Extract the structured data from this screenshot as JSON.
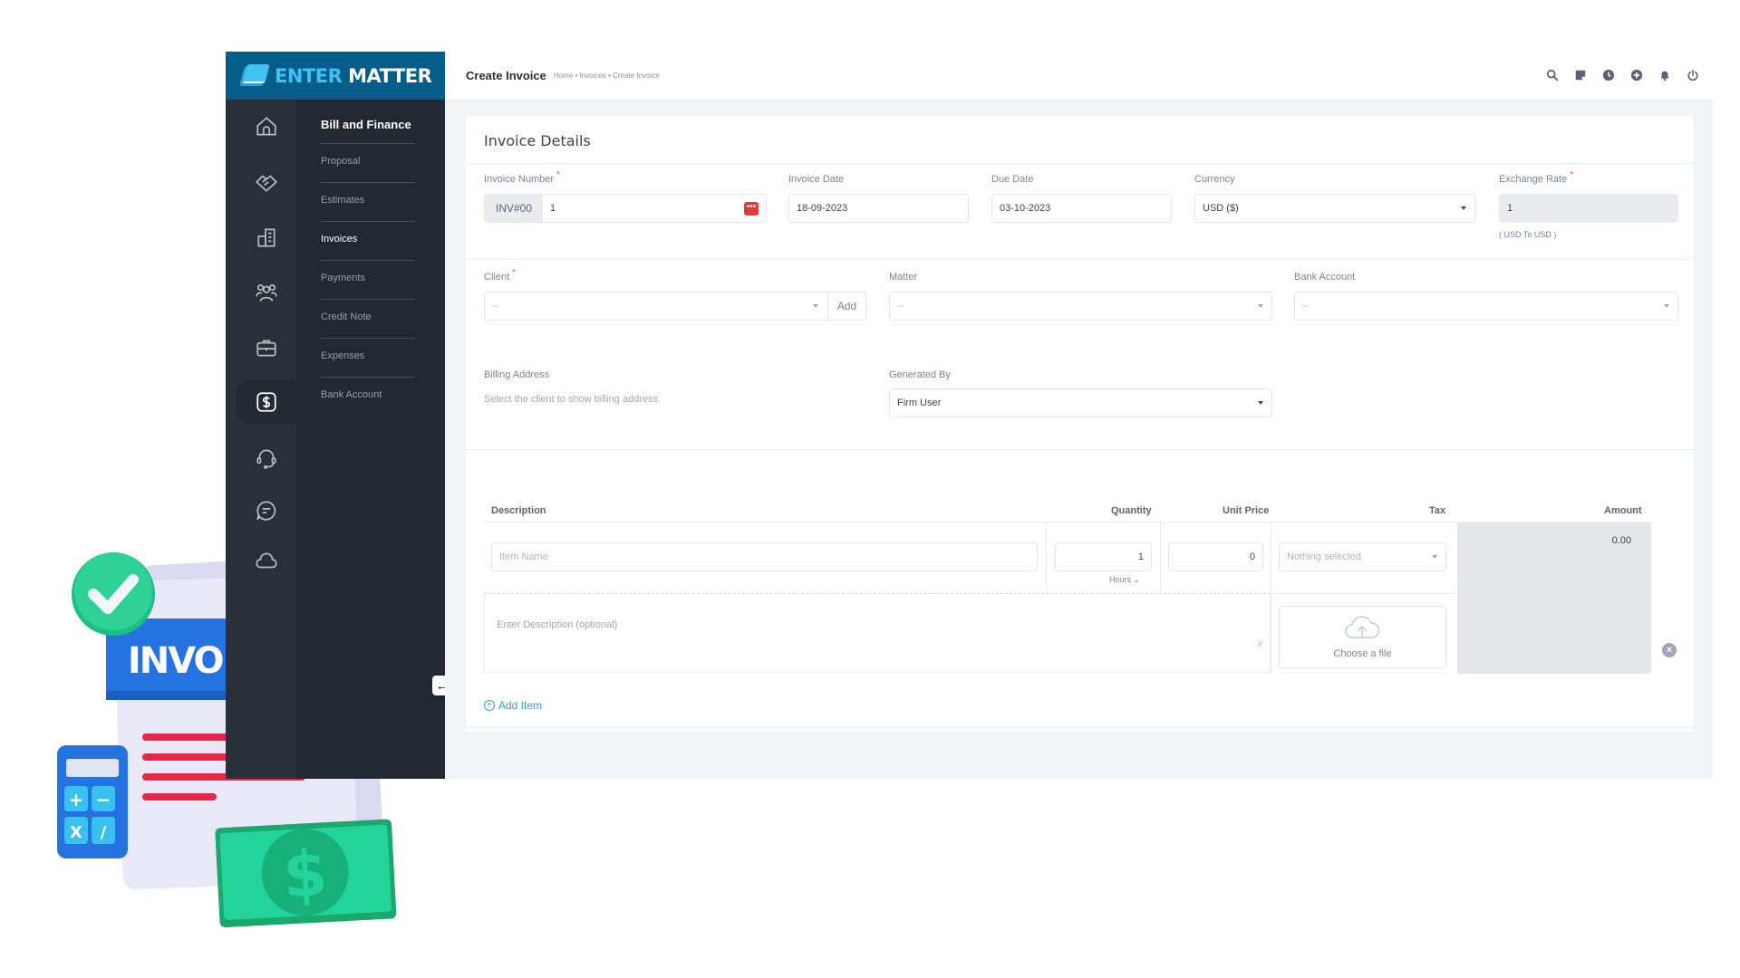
{
  "brand": {
    "name_part1": "ENTER",
    "name_part2": " MATTER"
  },
  "header": {
    "title": "Create Invoice",
    "breadcrumb": "Home • Invoices • Create Invoice",
    "icons": [
      "search-icon",
      "sticky-note-icon",
      "clock-icon",
      "plus-circle-icon",
      "bell-icon",
      "power-icon"
    ]
  },
  "sidebar": {
    "icons": [
      "home-icon",
      "handshake-icon",
      "building-icon",
      "users-icon",
      "briefcase-icon",
      "dollar-icon",
      "headset-icon",
      "chat-icon",
      "cloud-icon"
    ],
    "active_icon": "dollar-icon",
    "section_title": "Bill and Finance",
    "items": [
      {
        "label": "Proposal"
      },
      {
        "label": "Estimates"
      },
      {
        "label": "Invoices",
        "active": true
      },
      {
        "label": "Payments"
      },
      {
        "label": "Credit Note"
      },
      {
        "label": "Expenses"
      },
      {
        "label": "Bank Account"
      }
    ],
    "collapse_icon": "arrow-left-icon"
  },
  "form": {
    "title": "Invoice Details",
    "invoice_number": {
      "label": "Invoice Number",
      "required": "*",
      "prefix": "INV#00",
      "value": "1"
    },
    "invoice_date": {
      "label": "Invoice Date",
      "value": "18-09-2023"
    },
    "due_date": {
      "label": "Due Date",
      "value": "03-10-2023"
    },
    "currency": {
      "label": "Currency",
      "value": "USD ($)"
    },
    "exchange_rate": {
      "label": "Exchange Rate",
      "required": "*",
      "value": "1",
      "hint": "( USD To USD )"
    },
    "client": {
      "label": "Client",
      "required": "*",
      "placeholder": "--",
      "add_label": "Add"
    },
    "matter": {
      "label": "Matter",
      "placeholder": "--"
    },
    "bank_account": {
      "label": "Bank Account",
      "placeholder": "--"
    },
    "billing_address": {
      "label": "Billing Address",
      "helper": "Select the client to show billing address."
    },
    "generated_by": {
      "label": "Generated By",
      "value": "Firm User"
    }
  },
  "items": {
    "headers": {
      "description": "Description",
      "quantity": "Quantity",
      "unit_price": "Unit Price",
      "tax": "Tax",
      "amount": "Amount"
    },
    "rows": [
      {
        "item_name_placeholder": "Item Name",
        "quantity": "1",
        "unit": "Hours",
        "unit_price": "0",
        "tax_placeholder": "Nothing selected",
        "amount": "0.00",
        "description_placeholder": "Enter Description (optional)",
        "upload_label": "Choose a file"
      }
    ],
    "add_item_label": "Add Item"
  },
  "illustration": {
    "banner_text": "INVOICE",
    "calc_keys": [
      "+",
      "−",
      "X",
      "/"
    ],
    "currency_symbol": "$"
  }
}
